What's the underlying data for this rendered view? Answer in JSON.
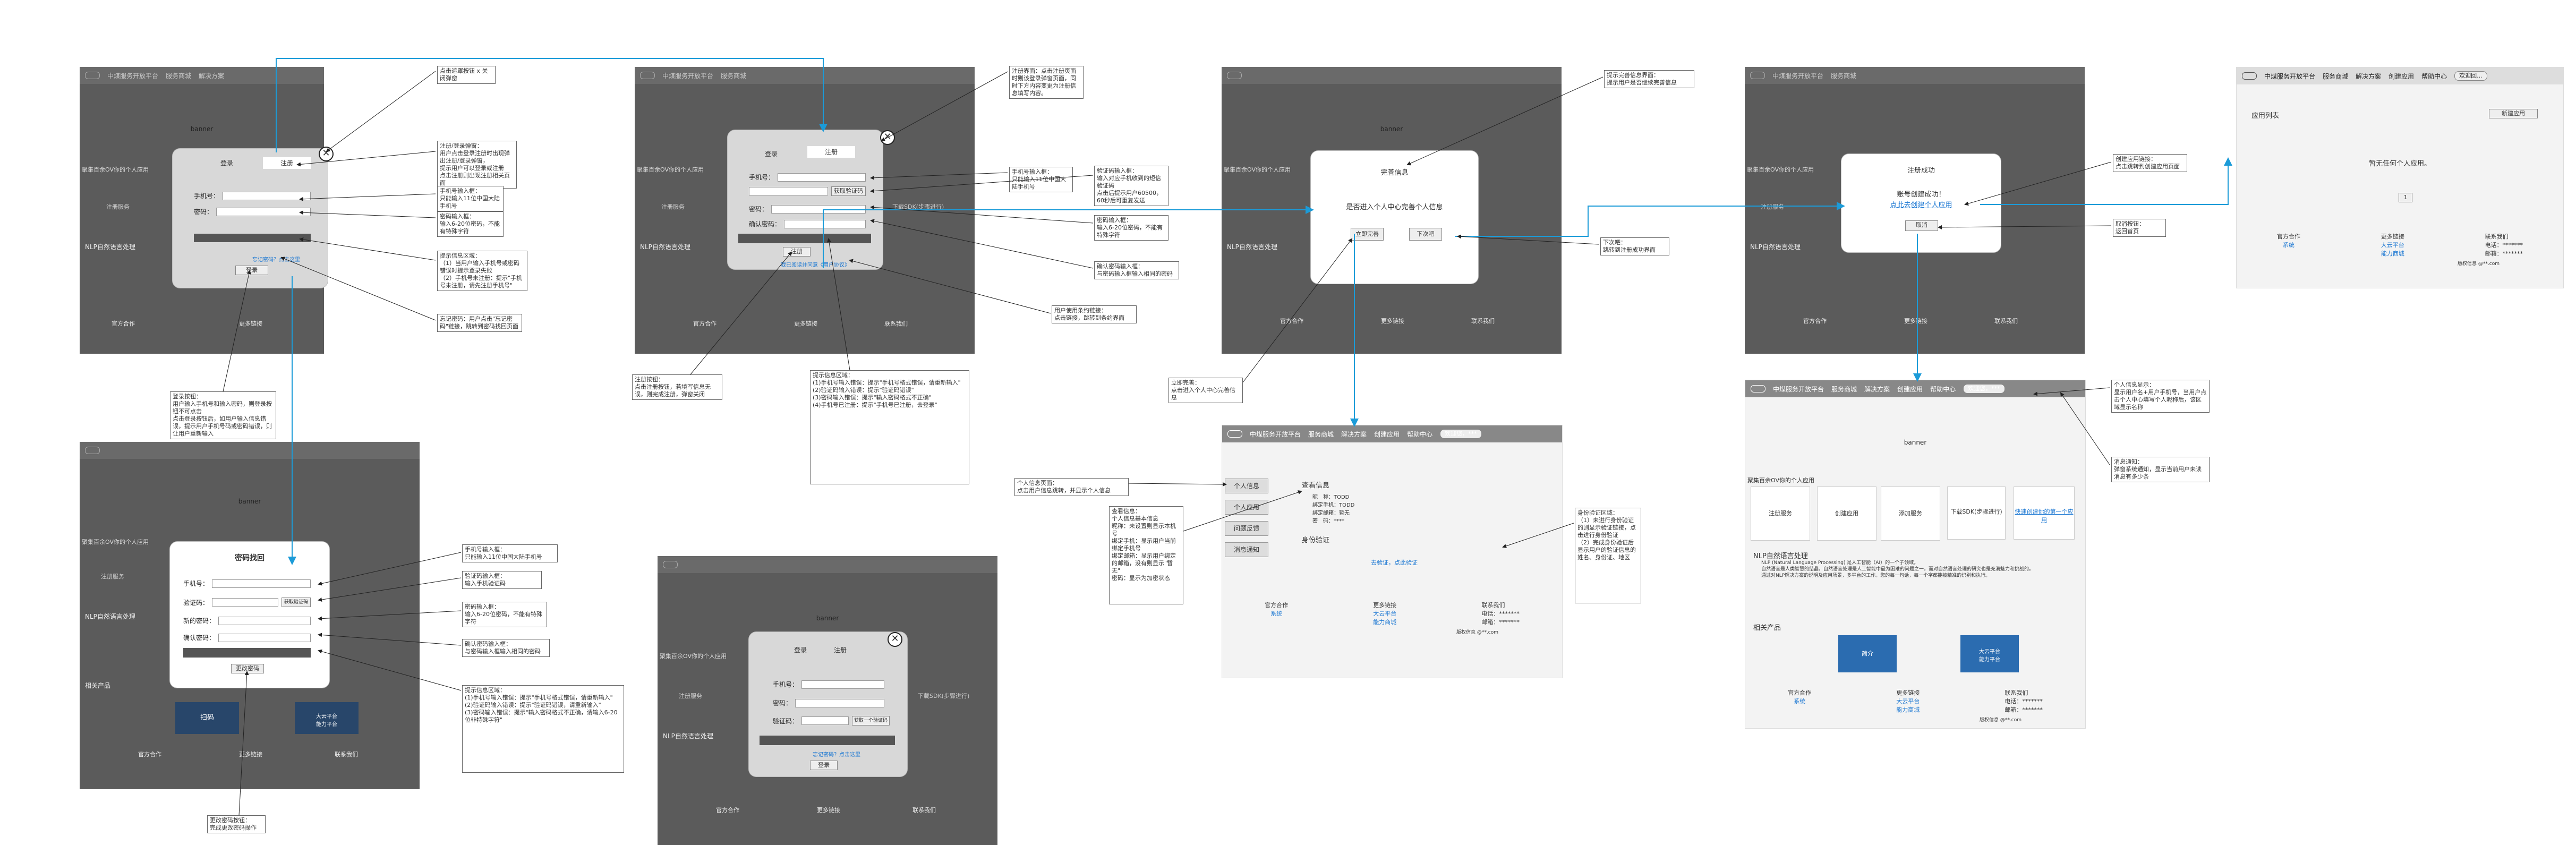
{
  "nav": {
    "logo": "LOGO",
    "brand": "中煤服务开放平台",
    "items": [
      "服务商城",
      "解决方案",
      "创建应用",
      "帮助中心"
    ],
    "login": "登录",
    "register": "注册",
    "welcome": "欢迎回...",
    "welcome_full": "欢迎您，***"
  },
  "common": {
    "banner": "banner",
    "hint": "聚集百余OV你的个人应用",
    "register_service": "注册服务",
    "create_app": "创建应用",
    "add_service": "添加服务",
    "download_sdk": "下载SDK(步骤进行)",
    "nlp_title": "NLP自然语言处理",
    "nlp_desc": "NLP (Natural Language Processing) 是人工智能（AI）的一个子领域。\n自然语言是人类智慧的结晶，自然语言处理是人工智能中最为困难的问题之一，而对自然语言处理的研究也是充满魅力和挑战的。\n通过对NLP解决方案的说明及应用场景，多平台的工作。您的每一句话，每一个字都能被精准的识别和执行。",
    "footer": {
      "partners": "官方合作",
      "partners_link": "系统",
      "more": "更多链接",
      "more_links": [
        "大云平台",
        "能力商城"
      ],
      "contact": "联系我们",
      "phone": "电话：*******",
      "email": "邮箱：*******",
      "copyright": "版权信息 @**.com"
    },
    "related": "相关产品"
  },
  "s1": {
    "tab_login": "登录",
    "tab_register": "注册",
    "phone_label": "手机号：",
    "pwd_label": "密码：",
    "forgot": "忘记密码？点击这里",
    "login_btn": "登录"
  },
  "s2": {
    "tab_login": "登录",
    "tab_register": "注册",
    "phone_label": "手机号：",
    "code_label": "验证码：",
    "get_code": "获取验证码",
    "pwd_label": "密码：",
    "pwd2_label": "确认密码：",
    "agree": "我已阅读并同意《用户协议》",
    "register_btn": "注册"
  },
  "s3": {
    "title": "完善信息",
    "question": "是否进入个人中心完善个人信息",
    "goto": "立即完善",
    "later": "下次吧"
  },
  "s4": {
    "title": "注册成功",
    "account": "账号创建成功！",
    "link": "点此去创建个人应用",
    "cancel": "取消"
  },
  "s5": {
    "title": "应用列表",
    "new_btn": "新建应用",
    "empty": "暂无任何个人应用。",
    "page": "1",
    "footer_small": "版权信息 @**.com"
  },
  "s6": {
    "title": "密码找回",
    "phone_label": "手机号：",
    "code_label": "验证码：",
    "get_code": "获取验证码",
    "new_pwd_label": "新的密码：",
    "pwd2_label": "确认密码：",
    "change_btn": "更改密码",
    "scan": "扫码",
    "scan2": "大云平台\n能力平台"
  },
  "s7": {
    "tab_login": "登录",
    "tab_register": "注册",
    "phone_label": "手机号：",
    "pwd_label": "密码：",
    "code_label": "验证码：",
    "get_code": "获取一个验证码",
    "forgot": "忘记密码？点击这里",
    "login_btn": "登录"
  },
  "s8": {
    "side": [
      "个人信息",
      "个人应用",
      "问题反馈",
      "消息通知"
    ],
    "info_title": "查看信息",
    "fields": [
      [
        "昵　称：",
        "TODD"
      ],
      [
        "绑定手机：",
        "TODD"
      ],
      [
        "绑定邮箱：",
        "暂无"
      ],
      [
        "密　码：",
        "****"
      ]
    ],
    "verify_title": "身份验证",
    "verify_link": "去验证，点此验证"
  },
  "s9": {
    "welcome": "欢迎您，***",
    "related_cards": [
      "简介",
      "大云平台\n能力平台"
    ],
    "cards": [
      "注册服务",
      "创建应用",
      "添加服务",
      "下载SDK(步骤进行)",
      "快速创建你的第一个应用"
    ]
  },
  "notes": {
    "n1": "点击遮罩按钮 x 关闭弹窗",
    "n2": "注册/登录弹窗：\n用户点击登录注册时出现弹出注册/登录弹窗，\n提示用户可以登录或注册\n点击注册则出现注册相关页面",
    "n3": "手机号输入框：\n只能输入11位中国大陆手机号",
    "n4": "密码输入框：\n输入6-20位密码，不能有特殊字符",
    "n5": "提示信息区域：\n（1）当用户输入手机号或密码错误时提示登录失败\n（2）手机号未注册：提示\"手机号未注册，请先注册手机号\"",
    "n6": "忘记密码：用户点击\"忘记密码\"链接，跳转到密码找回页面",
    "n7": "登录按钮：\n用户输入手机号和输入密码，则登录按钮不可点击\n点击登录按钮后，如用户输入信息错误，提示用户手机号码或密码错误，则让用户重新输入",
    "n8": "注册界面：点击注册页面时则该登录弹窗页面，同时下方内容变更为注册信息填写内容。",
    "n9": "手机号输入框：\n只能输入11位中国大陆手机号",
    "n10": "验证码输入框：\n输入对应手机收到的短信验证码\n点击后提示用户60500，60秒后可重复发送",
    "n11": "密码输入框：\n输入6-20位密码，不能有特殊字符",
    "n12": "确认密码输入框：\n与密码输入框输入相同的密码",
    "n13": "用户使用条约链接：\n点击链接，跳转到条约界面",
    "n14": "注册按钮：\n点击注册按钮，若填写信息无误，则完成注册，弹窗关闭",
    "n15": "提示信息区域：\n(1)手机号输入错误：提示\"手机号格式错误，请重新输入\"\n(2)验证码输入错误：提示\"验证码错误\"\n(3)密码输入错误：提示\"输入密码格式不正确\"\n(4)手机号已注册：提示\"手机号已注册，去登录\"",
    "n16": "提示完善信息界面：\n提示用户是否继续完善信息",
    "n17": "下次吧：\n跳转到注册成功界面",
    "n18": "立即完善：\n点击进入个人中心完善信息",
    "n19": "创建应用链接：\n点击跳转到创建应用页面",
    "n20": "取消按钮：\n返回首页",
    "n21": "个人信息显示：\n显示用户名+用户手机号，当用户点击个人中心填写个人昵称后，该区域显示名称",
    "n22": "消息通知：\n弹窗系统通知，显示当前用户未读消息有多少条",
    "n23": "个人信息页面：\n点击用户信息跳转，并显示个人信息",
    "n24": "查看信息：\n个人信息基本信息\n昵称：未设置则显示本机号\n绑定手机：显示用户当前绑定手机号\n绑定邮箱：显示用户绑定的邮箱，没有则显示\"暂无\"\n密码：显示为加密状态",
    "n25": "身份验证区域：\n（1）未进行身份验证的则显示验证链接，点击进行身份验证\n（2）完成身份验证后显示用户的验证信息的姓名、身份证、地区",
    "n26": "手机号输入框：\n只能输入11位中国大陆手机号",
    "n27": "验证码输入框：\n输入手机验证码",
    "n28": "密码输入框：\n输入6-20位密码，不能有特殊字符",
    "n29": "确认密码输入框：\n与密码输入框输入相同的密码",
    "n30": "提示信息区域：\n(1)手机号输入错误：提示\"手机号格式错误，请重新输入\"\n(2)验证码输入错误：提示\"验证码错误，请重新输入\"\n(3)密码输入错误：提示\"输入密码格式不正确，请输入6-20位非特殊字符\"",
    "n31": "更改密码按钮：\n完成更改密码操作"
  },
  "colors": {
    "arrow": "#1b9bd8",
    "dark_bg": "#5b5b5b",
    "modal_bg": "#d8d8d8",
    "red": "#dd0000",
    "link": "#1976d2"
  }
}
